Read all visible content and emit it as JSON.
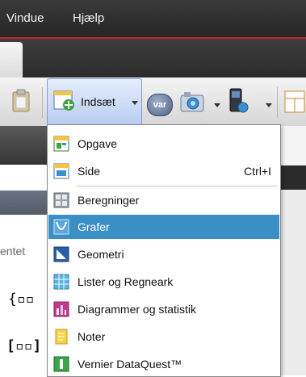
{
  "menubar": {
    "items": [
      {
        "label": "Vindue"
      },
      {
        "label": "Hjælp"
      }
    ]
  },
  "toolbar": {
    "insert_label": "Indsæt",
    "var_label": "var"
  },
  "left_panel": {
    "partial_text": "entet"
  },
  "insert_menu": {
    "items": [
      {
        "label": "Opgave",
        "icon": "problem-icon",
        "shortcut": ""
      },
      {
        "label": "Side",
        "icon": "page-icon",
        "shortcut": "Ctrl+I"
      },
      {
        "label": "Beregninger",
        "icon": "calculator-icon",
        "shortcut": ""
      },
      {
        "label": "Grafer",
        "icon": "graphs-icon",
        "shortcut": "",
        "highlighted": true
      },
      {
        "label": "Geometri",
        "icon": "geometry-icon",
        "shortcut": ""
      },
      {
        "label": "Lister og Regneark",
        "icon": "spreadsheet-icon",
        "shortcut": ""
      },
      {
        "label": "Diagrammer og statistik",
        "icon": "data-statistics-icon",
        "shortcut": ""
      },
      {
        "label": "Noter",
        "icon": "notes-icon",
        "shortcut": ""
      },
      {
        "label": "Vernier DataQuest™",
        "icon": "vernier-icon",
        "shortcut": ""
      }
    ]
  },
  "colors": {
    "highlight": "#3a8fc4",
    "menubar": "#2f2f2f",
    "accent_red": "#c0262c"
  }
}
